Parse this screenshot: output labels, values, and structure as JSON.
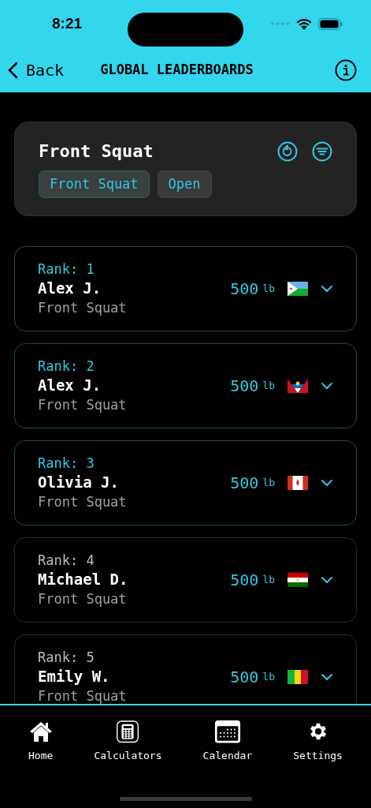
{
  "status_bar": {
    "time": "8:21"
  },
  "nav": {
    "back": "Back",
    "title": "GLOBAL LEADERBOARDS"
  },
  "filter_card": {
    "title": "Front Squat",
    "chips": [
      {
        "label": "Front Squat",
        "selected": true
      },
      {
        "label": "Open",
        "selected": false
      }
    ]
  },
  "entries": [
    {
      "rank": "Rank: 1",
      "name": "Alex J.",
      "lift": "Front Squat",
      "weight": "500",
      "unit": "lb",
      "kind": "djibouti",
      "podium": true
    },
    {
      "rank": "Rank: 2",
      "name": "Alex J.",
      "lift": "Front Squat",
      "weight": "500",
      "unit": "lb",
      "kind": "antigua",
      "podium": true
    },
    {
      "rank": "Rank: 3",
      "name": "Olivia J.",
      "lift": "Front Squat",
      "weight": "500",
      "unit": "lb",
      "kind": "canada",
      "podium": true
    },
    {
      "rank": "Rank: 4",
      "name": "Michael D.",
      "lift": "Front Squat",
      "weight": "500",
      "unit": "lb",
      "kind": "tajikistan",
      "podium": false
    },
    {
      "rank": "Rank: 5",
      "name": "Emily W.",
      "lift": "Front Squat",
      "weight": "500",
      "unit": "lb",
      "kind": "mali",
      "podium": false
    }
  ],
  "tab_bar": [
    {
      "label": "Home",
      "kind": "home"
    },
    {
      "label": "Calculators",
      "kind": "calculator"
    },
    {
      "label": "Calendar",
      "kind": "calendar"
    },
    {
      "label": "Settings",
      "kind": "settings"
    }
  ]
}
